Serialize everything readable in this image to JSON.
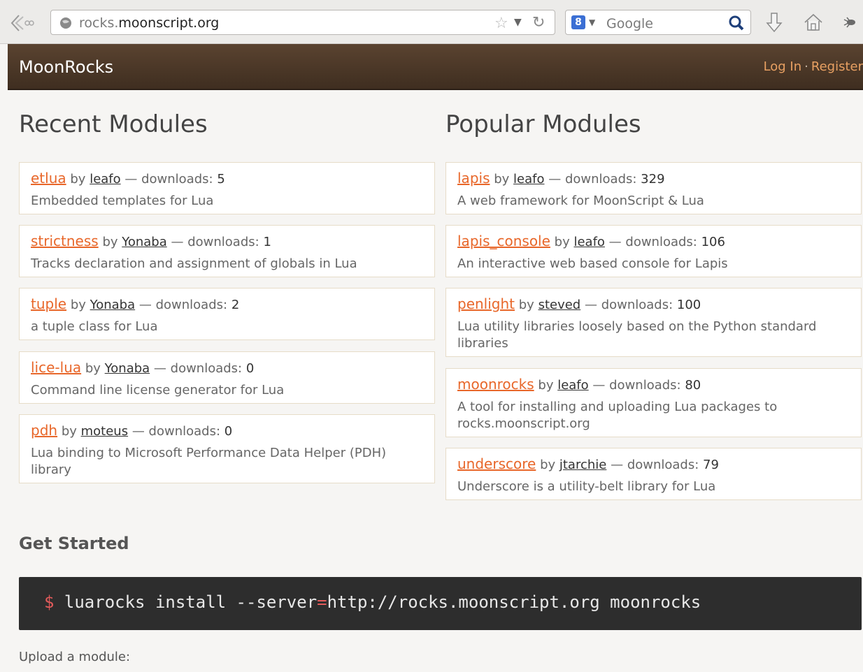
{
  "browser": {
    "url_prefix": "rocks.",
    "url_domain": "moonscript.org",
    "search_placeholder": "Google"
  },
  "header": {
    "brand": "MoonRocks",
    "login": "Log In",
    "separator": "·",
    "register": "Register"
  },
  "recent": {
    "title": "Recent Modules",
    "items": [
      {
        "name": "etlua",
        "by": "by",
        "user": "leafo",
        "dl_label": "— downloads:",
        "downloads": "5",
        "desc": "Embedded templates for Lua"
      },
      {
        "name": "strictness",
        "by": "by",
        "user": "Yonaba",
        "dl_label": "— downloads:",
        "downloads": "1",
        "desc": "Tracks declaration and assignment of globals in Lua"
      },
      {
        "name": "tuple",
        "by": "by",
        "user": "Yonaba",
        "dl_label": "— downloads:",
        "downloads": "2",
        "desc": "a tuple class for Lua"
      },
      {
        "name": "lice-lua",
        "by": "by",
        "user": "Yonaba",
        "dl_label": "— downloads:",
        "downloads": "0",
        "desc": "Command line license generator for Lua"
      },
      {
        "name": "pdh",
        "by": "by",
        "user": "moteus",
        "dl_label": "— downloads:",
        "downloads": "0",
        "desc": "Lua binding to Microsoft Performance Data Helper (PDH) library"
      }
    ]
  },
  "popular": {
    "title": "Popular Modules",
    "items": [
      {
        "name": "lapis",
        "by": "by",
        "user": "leafo",
        "dl_label": "— downloads:",
        "downloads": "329",
        "desc": "A web framework for MoonScript & Lua"
      },
      {
        "name": "lapis_console",
        "by": "by",
        "user": "leafo",
        "dl_label": "— downloads:",
        "downloads": "106",
        "desc": "An interactive web based console for Lapis"
      },
      {
        "name": "penlight",
        "by": "by",
        "user": "steved",
        "dl_label": "— downloads:",
        "downloads": "100",
        "desc": "Lua utility libraries loosely based on the Python standard libraries"
      },
      {
        "name": "moonrocks",
        "by": "by",
        "user": "leafo",
        "dl_label": "— downloads:",
        "downloads": "80",
        "desc": "A tool for installing and uploading Lua packages to rocks.moonscript.org"
      },
      {
        "name": "underscore",
        "by": "by",
        "user": "jtarchie",
        "dl_label": "— downloads:",
        "downloads": "79",
        "desc": "Underscore is a utility-belt library for Lua"
      }
    ]
  },
  "get_started": {
    "title": "Get Started",
    "prompt": "$",
    "cmd_part1": "luarocks install --server",
    "cmd_eq": "=",
    "cmd_part2": "http://rocks.moonscript.org moonrocks",
    "upload": "Upload a module:"
  },
  "colors": {
    "accent": "#e8672a",
    "header_bg": "#4a3626",
    "code_bg": "#2d2d2d"
  }
}
